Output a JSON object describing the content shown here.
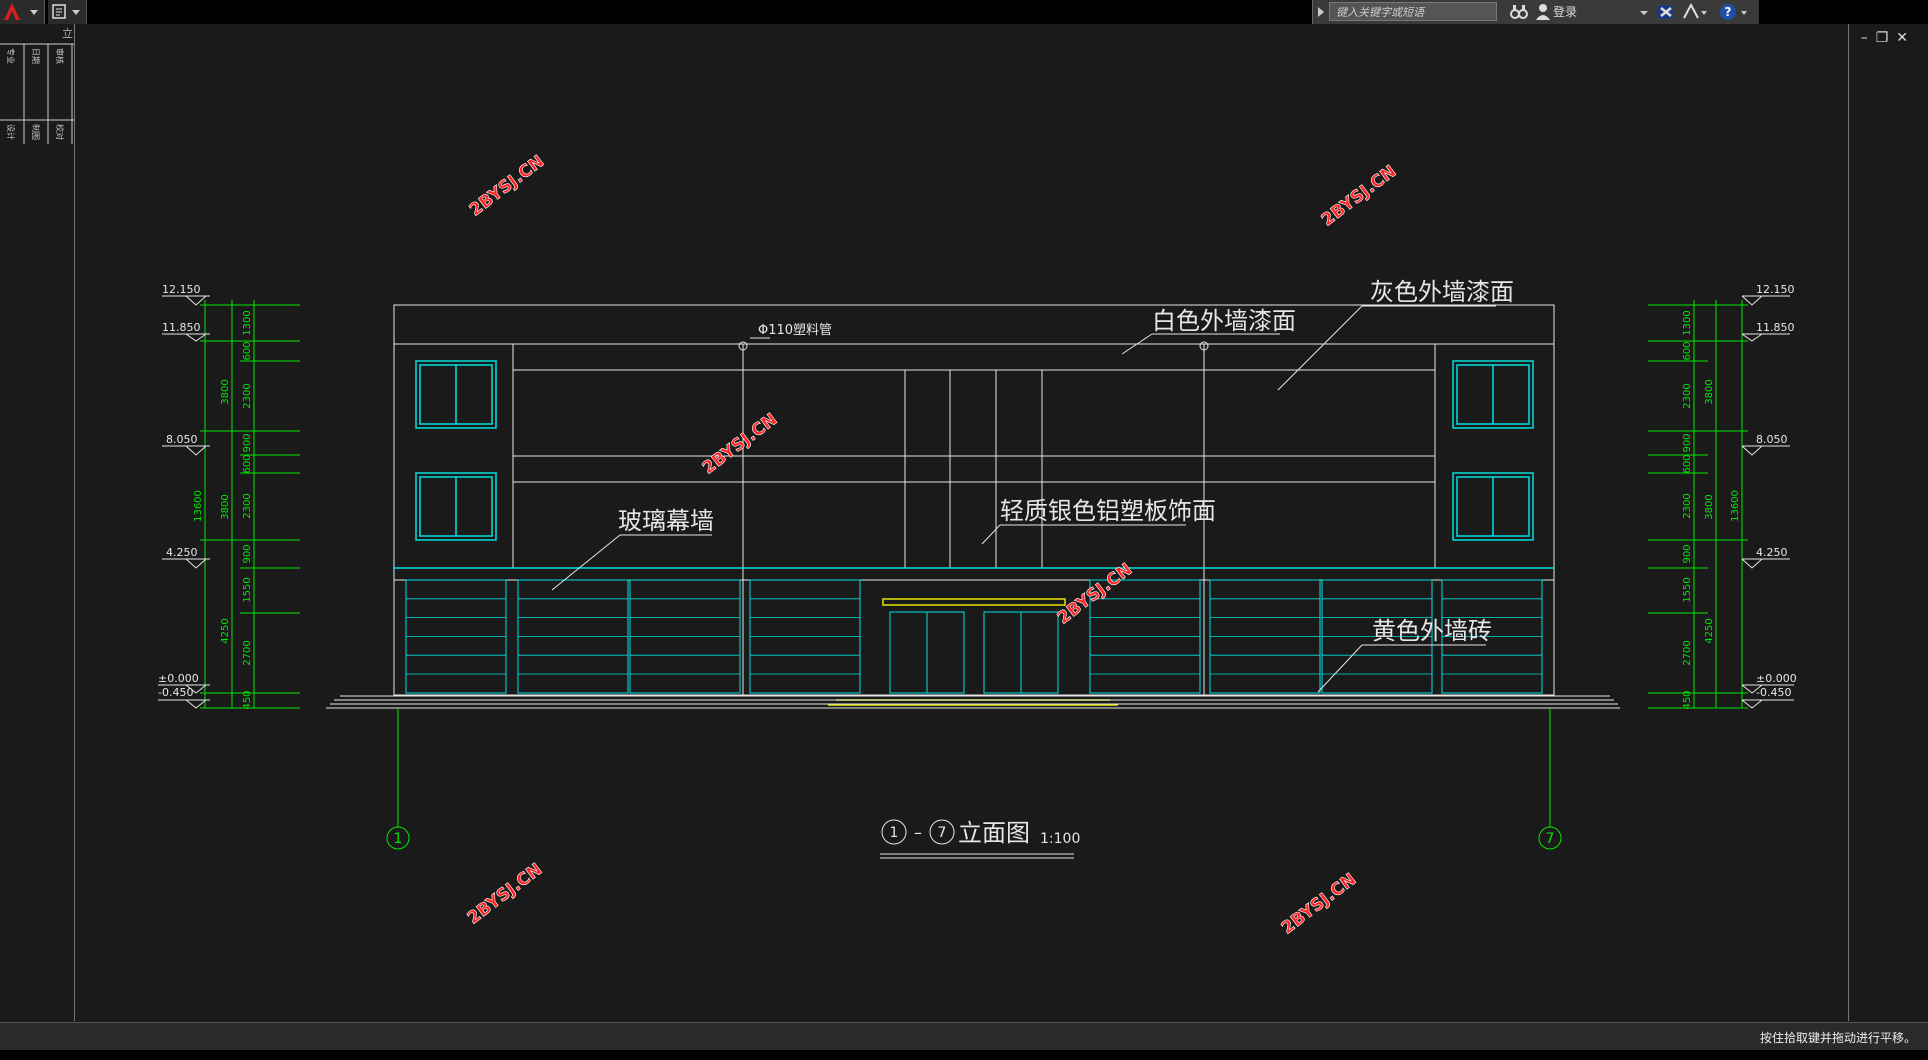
{
  "search": {
    "placeholder": "键入关键字或短语"
  },
  "infocenter": {
    "login_label": "登录",
    "help_label": "?"
  },
  "window": {
    "minimize": "–",
    "restore": "❐",
    "close": "✕"
  },
  "left_panel": {
    "tab_fragment": "立面图",
    "row1": [
      "专业",
      "日期",
      "审核"
    ],
    "row2": [
      "设计",
      "制图",
      "校对"
    ]
  },
  "status": {
    "text": "按住拾取键并拖动进行平移。"
  },
  "drawing": {
    "title": "立面图",
    "title_axis_from": "1",
    "title_axis_to": "7",
    "title_dash": "–",
    "scale": "1:100",
    "axis_left": "1",
    "axis_right": "7",
    "labels": {
      "white_paint": "白色外墙漆面",
      "gray_paint": "灰色外墙漆面",
      "pipe": "Φ110塑料管",
      "glass_wall": "玻璃幕墙",
      "alu_panel": "轻质银色铝塑板饰面",
      "yellow_tile": "黄色外墙砖"
    },
    "elevations": [
      "12.150",
      "11.850",
      "8.050",
      "4.250",
      "±0.000",
      "-0.450"
    ],
    "dims_inner": [
      "1300",
      "600",
      "2300",
      "900",
      "600",
      "2300",
      "900",
      "1550",
      "2700",
      "450"
    ],
    "dims_middle": [
      "3800",
      "3800",
      "4250"
    ],
    "dims_total": "13600",
    "watermark": "2BYSJ.CN"
  },
  "colors": {
    "line": "#e6e6e6",
    "dim": "#00e600",
    "cyan": "#00e0e0",
    "yellow": "#e6e600",
    "watermark": "#ff2222"
  }
}
